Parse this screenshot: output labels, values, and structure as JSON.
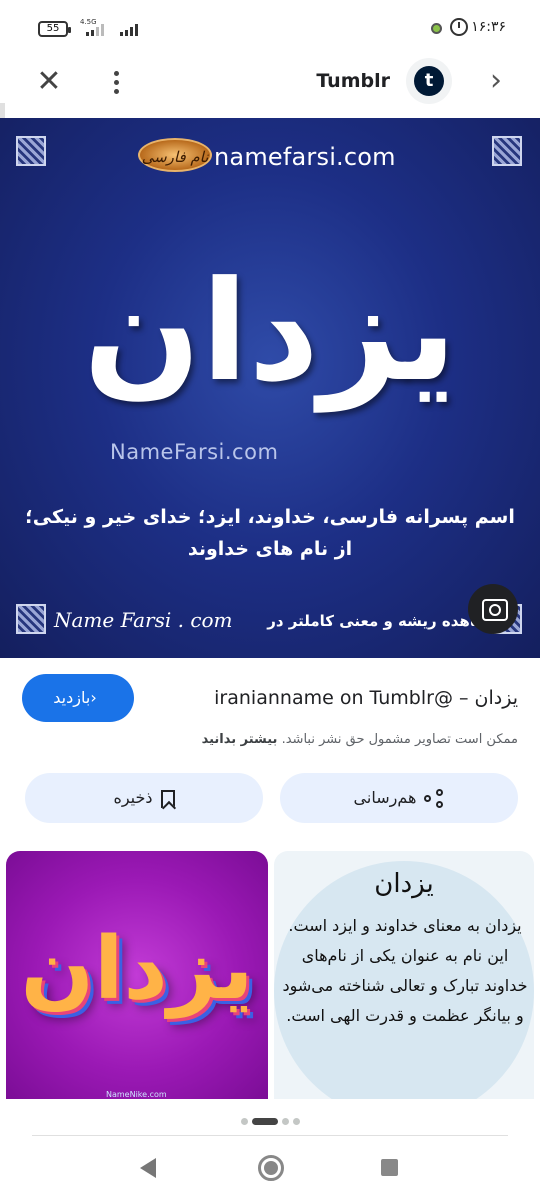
{
  "status_bar": {
    "battery": "55",
    "network": "4.5G",
    "time": "۱۶:۳۶"
  },
  "header": {
    "site_name": "Tumblr",
    "site_logo_letter": "t",
    "close_icon": "✕",
    "next_icon": "›"
  },
  "image": {
    "brand_badge": "نام فارسی",
    "brand_domain": "namefarsi.com",
    "main_name": "یزدان",
    "watermark": "NameFarsi.com",
    "caption_line1": "اسم پسرانه فارسی، خداوند، ایزد؛ خدای خیر و نیکی؛",
    "caption_line2": "از نام های خداوند",
    "footer_signature": "Name Farsi . com",
    "footer_text": "مشاهده ریشه و معنی کاملتر در"
  },
  "result": {
    "visit_label": "بازدید",
    "title": "یزدان – @iranianname on Tumblr",
    "copyright_text": "ممکن است تصاویر مشمول حق نشر نباشد.",
    "learn_more": "بیشتر بدانید"
  },
  "actions": {
    "save_label": "ذخیره",
    "share_label": "هم‌رسانی"
  },
  "related": [
    {
      "name_text": "یزدان",
      "small_caption": "NameNike.com"
    },
    {
      "title": "یزدان",
      "body": "یزدان به معنای خداوند و ایزد است. این نام به عنوان یکی از نام‌های خداوند تبارک و تعالی شناخته می‌شود و بیانگر عظمت و قدرت الهی است."
    }
  ],
  "pager": {
    "count": 4,
    "active_index": 1
  },
  "colors": {
    "accent": "#1a73e8",
    "tonal_button": "#e8f0fe",
    "image_bg": "#1d2f86"
  }
}
